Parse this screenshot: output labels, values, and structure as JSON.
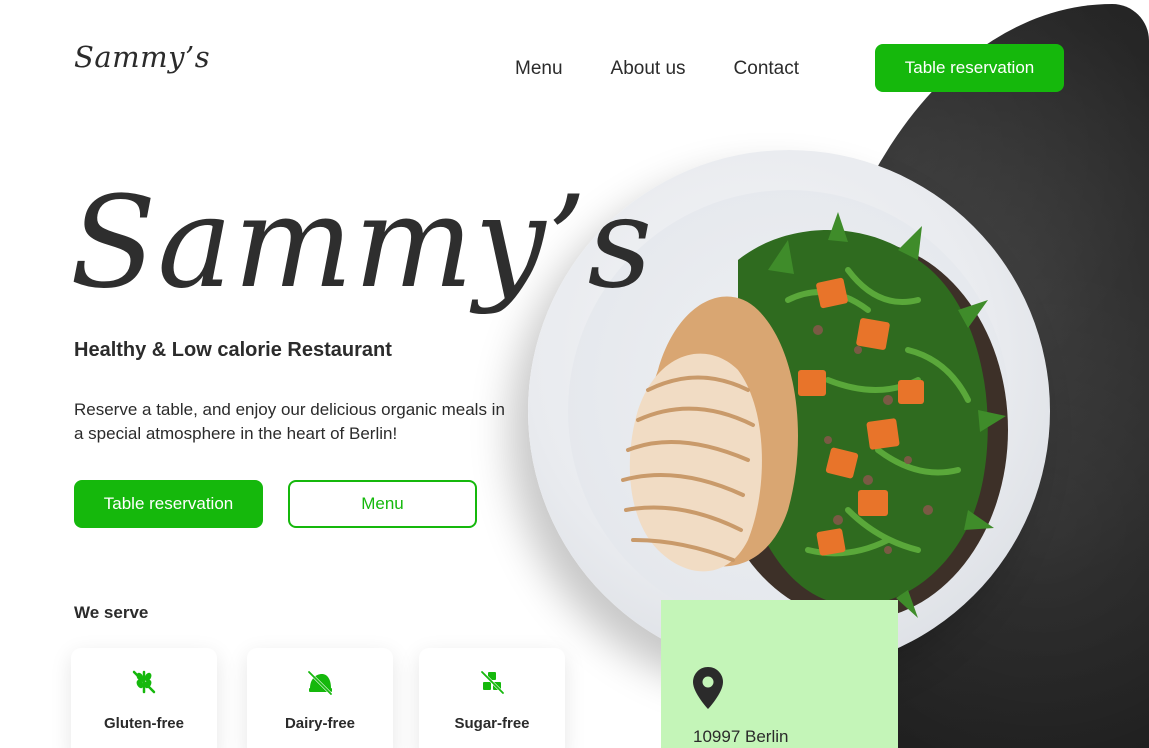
{
  "header": {
    "logo": "Sammy’s",
    "nav": [
      "Menu",
      "About us",
      "Contact"
    ],
    "cta_label": "Table reservation"
  },
  "hero": {
    "title": "Sammy’s",
    "subtitle": "Healthy & Low calorie Restaurant",
    "description": "Reserve a table, and enjoy our delicious organic meals in a special atmosphere in the heart of Berlin!",
    "primary_button": "Table reservation",
    "secondary_button": "Menu"
  },
  "serve": {
    "heading": "We serve",
    "items": [
      {
        "label": "Gluten-free",
        "icon": "gluten-free-icon"
      },
      {
        "label": "Dairy-free",
        "icon": "dairy-free-icon"
      },
      {
        "label": "Sugar-free",
        "icon": "sugar-free-icon"
      }
    ]
  },
  "location": {
    "icon": "location-pin-icon",
    "text": "10997 Berlin"
  },
  "colors": {
    "accent": "#15b80c",
    "dark_background": "#262626",
    "location_card": "#c4f5b8"
  }
}
